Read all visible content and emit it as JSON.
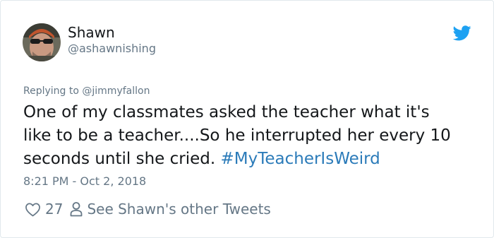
{
  "author": {
    "display_name": "Shawn",
    "handle": "@ashawnishing",
    "avatar_icon": "avatar-photo"
  },
  "header": {
    "logo_icon": "twitter-bird-icon",
    "brand_color": "#1da1f2"
  },
  "reply": {
    "label": "Replying to",
    "mention": "@jimmyfallon"
  },
  "tweet": {
    "line1": "One of my classmates asked the teacher what it's",
    "line2": "like to be a teacher....So he interrupted her every 10",
    "line3_text": "seconds until she cried.",
    "hashtag": "#MyTeacherIsWeird",
    "hashtag_color": "#2b7bb9"
  },
  "meta": {
    "timestamp": "8:21 PM - Oct 2, 2018"
  },
  "actions": {
    "like_icon": "heart-icon",
    "like_count": "27",
    "profile_icon": "person-icon",
    "other_tweets_label": "See Shawn's other Tweets"
  }
}
